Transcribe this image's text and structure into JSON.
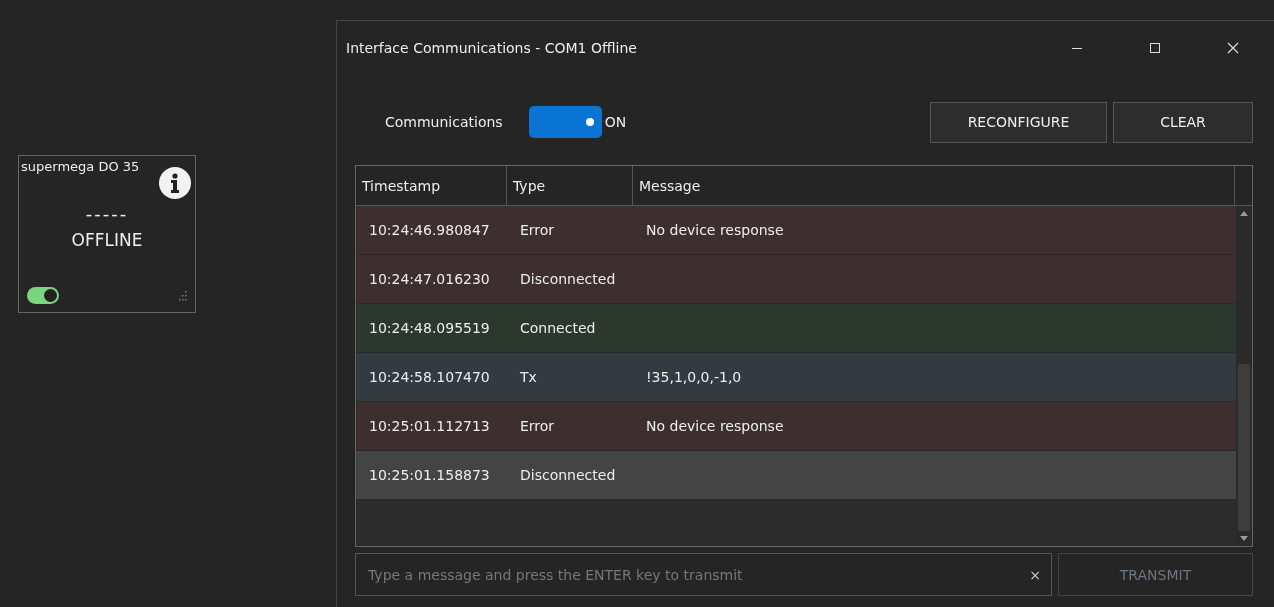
{
  "device_tile": {
    "name": "supermega DO 35",
    "reading": "-----",
    "status": "OFFLINE",
    "enabled": true
  },
  "window": {
    "title": "Interface Communications - COM1 Offline"
  },
  "communications": {
    "label": "Communications",
    "on": true,
    "state_text": "ON"
  },
  "buttons": [
    {
      "label": "RECONFIGURE",
      "disabled": false
    },
    {
      "label": "CLEAR",
      "disabled": false
    }
  ],
  "table": {
    "columns": [
      "Timestamp",
      "Type",
      "Message"
    ],
    "rows": [
      {
        "kind": "error",
        "selected": false,
        "cells": [
          "10:24:46.980847",
          "Error",
          "No device response"
        ]
      },
      {
        "kind": "error",
        "selected": false,
        "cells": [
          "10:24:47.016230",
          "Disconnected",
          ""
        ]
      },
      {
        "kind": "connected",
        "selected": false,
        "cells": [
          "10:24:48.095519",
          "Connected",
          ""
        ]
      },
      {
        "kind": "tx",
        "selected": false,
        "cells": [
          "10:24:58.107470",
          "Tx",
          "!35,1,0,0,-1,0"
        ]
      },
      {
        "kind": "error",
        "selected": false,
        "cells": [
          "10:25:01.112713",
          "Error",
          "No device response"
        ]
      },
      {
        "kind": "error",
        "selected": true,
        "cells": [
          "10:25:01.158873",
          "Disconnected",
          ""
        ]
      }
    ]
  },
  "message_field": {
    "placeholder": "Type a message and press the ENTER key to transmit",
    "clear_glyph": "×"
  },
  "transmit_button": {
    "label": "TRANSMIT",
    "disabled": true
  }
}
